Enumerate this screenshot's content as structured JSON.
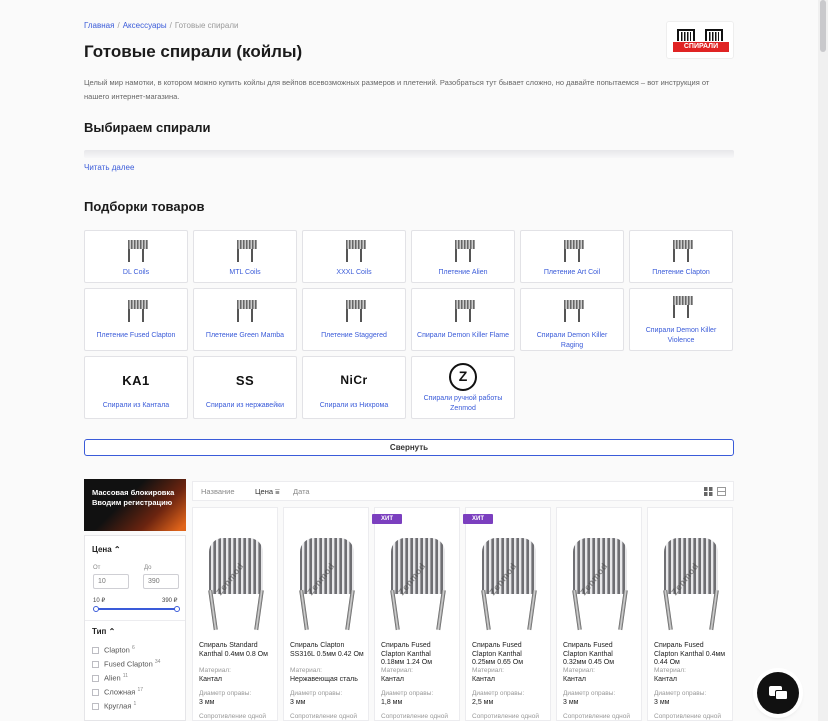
{
  "breadcrumb": {
    "home": "Главная",
    "accessories": "Аксессуары",
    "current": "Готовые спирали"
  },
  "title": "Готовые спирали (койлы)",
  "brand_tag": "СПИРАЛИ",
  "intro": "Целый мир намотки, в котором можно купить койлы для вейпов всевозможных размеров и плетений. Разобраться тут бывает сложно, но давайте попытаемся – вот инструкция от нашего интернет-магазина.",
  "section_choose": "Выбираем спирали",
  "read_more": "Читать далее",
  "section_collections": "Подборки товаров",
  "collections": [
    {
      "label": "DL Coils",
      "icon": "coil-icon"
    },
    {
      "label": "MTL Coils",
      "icon": "coil-icon"
    },
    {
      "label": "XXXL Coils",
      "icon": "coil-icon"
    },
    {
      "label": "Плетение Alien",
      "icon": "coil-icon"
    },
    {
      "label": "Плетение Art Coil",
      "icon": "coil-icon"
    },
    {
      "label": "Плетение Clapton",
      "icon": "coil-icon"
    },
    {
      "label": "Плетение Fused Clapton",
      "icon": "coil-icon"
    },
    {
      "label": "Плетение Green Mamba",
      "icon": "coil-icon"
    },
    {
      "label": "Плетение Staggered",
      "icon": "coil-icon"
    },
    {
      "label": "Спирали Demon Killer Flame",
      "icon": "coil-icon"
    },
    {
      "label": "Спирали Demon Killer Raging",
      "icon": "coil-icon"
    },
    {
      "label": "Спирали Demon Killer Violence",
      "icon": "coil-icon"
    },
    {
      "label": "Спирали из Кантала",
      "logo": "KA1"
    },
    {
      "label": "Спирали из нержавейки",
      "logo": "SS"
    },
    {
      "label": "Спирали из Нихрома",
      "logo": "NiCr"
    },
    {
      "label": "Спирали ручной работы Zenmod",
      "logo": "Z"
    }
  ],
  "collapse_label": "Свернуть",
  "side_banner": "Массовая блокировка Вводим регистрацию",
  "filters": {
    "price_title": "Цена",
    "from_label": "От",
    "to_label": "До",
    "from_placeholder": "10",
    "to_placeholder": "390",
    "min_price": "10 ₽",
    "max_price": "390 ₽",
    "type_title": "Тип",
    "types": [
      {
        "label": "Clapton",
        "count": "6"
      },
      {
        "label": "Fused Clapton",
        "count": "34"
      },
      {
        "label": "Alien",
        "count": "11"
      },
      {
        "label": "Сложная",
        "count": "17"
      },
      {
        "label": "Круглая",
        "count": "1"
      }
    ]
  },
  "sort": {
    "name": "Название",
    "price": "Цена",
    "date": "Дата"
  },
  "products": [
    {
      "name": "Спираль Standard Kanthal 0.4мм 0.8 Ом",
      "badge": "",
      "material_label": "Материал:",
      "material": "Кантал",
      "diameter_label": "Диаметр оправы:",
      "diameter": "3 мм",
      "resist_label": "Сопротивление одной"
    },
    {
      "name": "Спираль Clapton SS316L 0.5мм 0.42 Ом",
      "badge": "",
      "material_label": "Материал:",
      "material": "Нержавеющая сталь",
      "diameter_label": "Диаметр оправы:",
      "diameter": "3 мм",
      "resist_label": "Сопротивление одной"
    },
    {
      "name": "Спираль Fused Clapton Kanthal 0.18мм 1.24 Ом",
      "badge": "ХИТ",
      "material_label": "Материал:",
      "material": "Кантал",
      "diameter_label": "Диаметр оправы:",
      "diameter": "1,8 мм",
      "resist_label": "Сопротивление одной"
    },
    {
      "name": "Спираль Fused Clapton Kanthal 0.25мм 0.65 Ом",
      "badge": "ХИТ",
      "material_label": "Материал:",
      "material": "Кантал",
      "diameter_label": "Диаметр оправы:",
      "diameter": "2,5 мм",
      "resist_label": "Сопротивление одной"
    },
    {
      "name": "Спираль Fused Clapton Kanthal 0.32мм 0.45 Ом",
      "badge": "",
      "material_label": "Материал:",
      "material": "Кантал",
      "diameter_label": "Диаметр оправы:",
      "diameter": "3 мм",
      "resist_label": "Сопротивление одной"
    },
    {
      "name": "Спираль Fused Clapton Kanthal 0.4мм 0.44 Ом",
      "badge": "",
      "material_label": "Материал:",
      "material": "Кантал",
      "diameter_label": "Диаметр оправы:",
      "diameter": "3 мм",
      "resist_label": "Сопротивление одной"
    }
  ],
  "watermark": "Zenmod",
  "chat_icon": "chat-icon"
}
